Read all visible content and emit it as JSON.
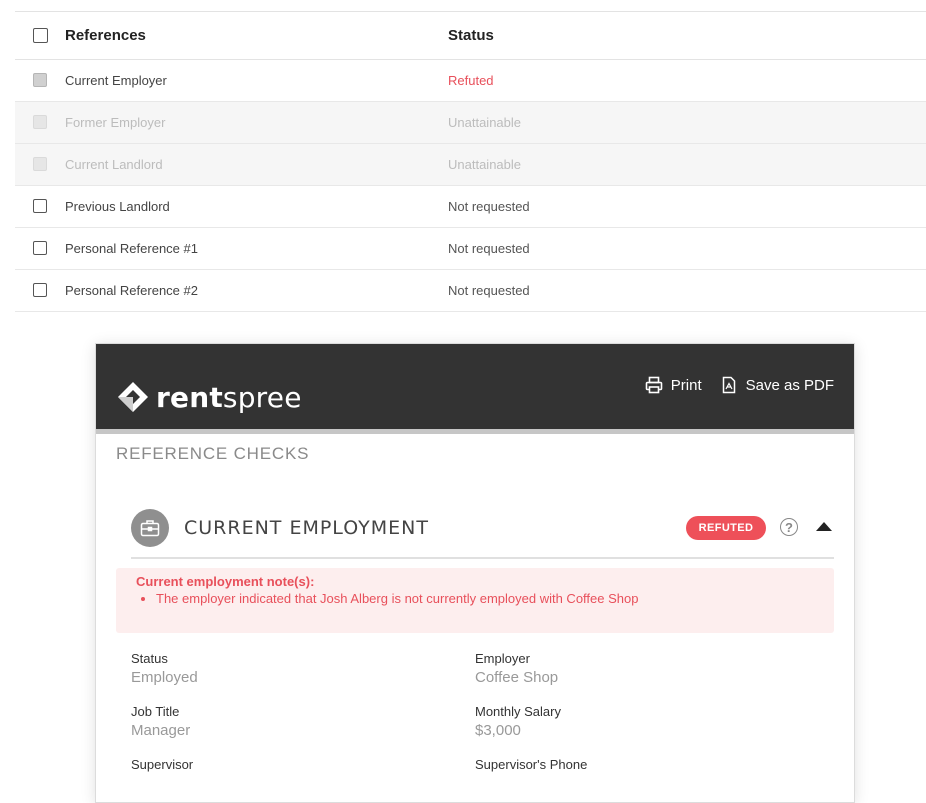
{
  "references_table": {
    "headers": {
      "references": "References",
      "status": "Status"
    },
    "rows": [
      {
        "reference": "Current Employer",
        "status": "Refuted",
        "state": "selected"
      },
      {
        "reference": "Former Employer",
        "status": "Unattainable",
        "state": "disabled"
      },
      {
        "reference": "Current Landlord",
        "status": "Unattainable",
        "state": "disabled"
      },
      {
        "reference": "Previous Landlord",
        "status": "Not requested",
        "state": "normal"
      },
      {
        "reference": "Personal Reference #1",
        "status": "Not requested",
        "state": "normal"
      },
      {
        "reference": "Personal Reference #2",
        "status": "Not requested",
        "state": "normal"
      }
    ]
  },
  "report": {
    "logo": {
      "part1": "rent",
      "part2": "spree"
    },
    "actions": {
      "print": "Print",
      "save_pdf": "Save as PDF"
    },
    "section_title": "REFERENCE CHECKS",
    "employment": {
      "title": "CURRENT EMPLOYMENT",
      "badge": "REFUTED",
      "notes_title": "Current employment note(s):",
      "notes": [
        "The employer indicated that Josh Alberg is not currently employed with Coffee Shop"
      ],
      "fields": {
        "status": {
          "label": "Status",
          "value": "Employed"
        },
        "employer": {
          "label": "Employer",
          "value": "Coffee Shop"
        },
        "job_title": {
          "label": "Job Title",
          "value": "Manager"
        },
        "monthly_salary": {
          "label": "Monthly Salary",
          "value": "$3,000"
        },
        "supervisor": {
          "label": "Supervisor",
          "value": ""
        },
        "supervisor_phone": {
          "label": "Supervisor's Phone",
          "value": ""
        }
      }
    }
  },
  "colors": {
    "refuted_red": "#e8505b",
    "header_dark": "#333333",
    "notes_bg": "#fdeeee"
  },
  "icons": [
    "print-icon",
    "pdf-icon",
    "briefcase-icon",
    "help-icon",
    "collapse-arrow-icon",
    "rentspree-logo-icon"
  ]
}
